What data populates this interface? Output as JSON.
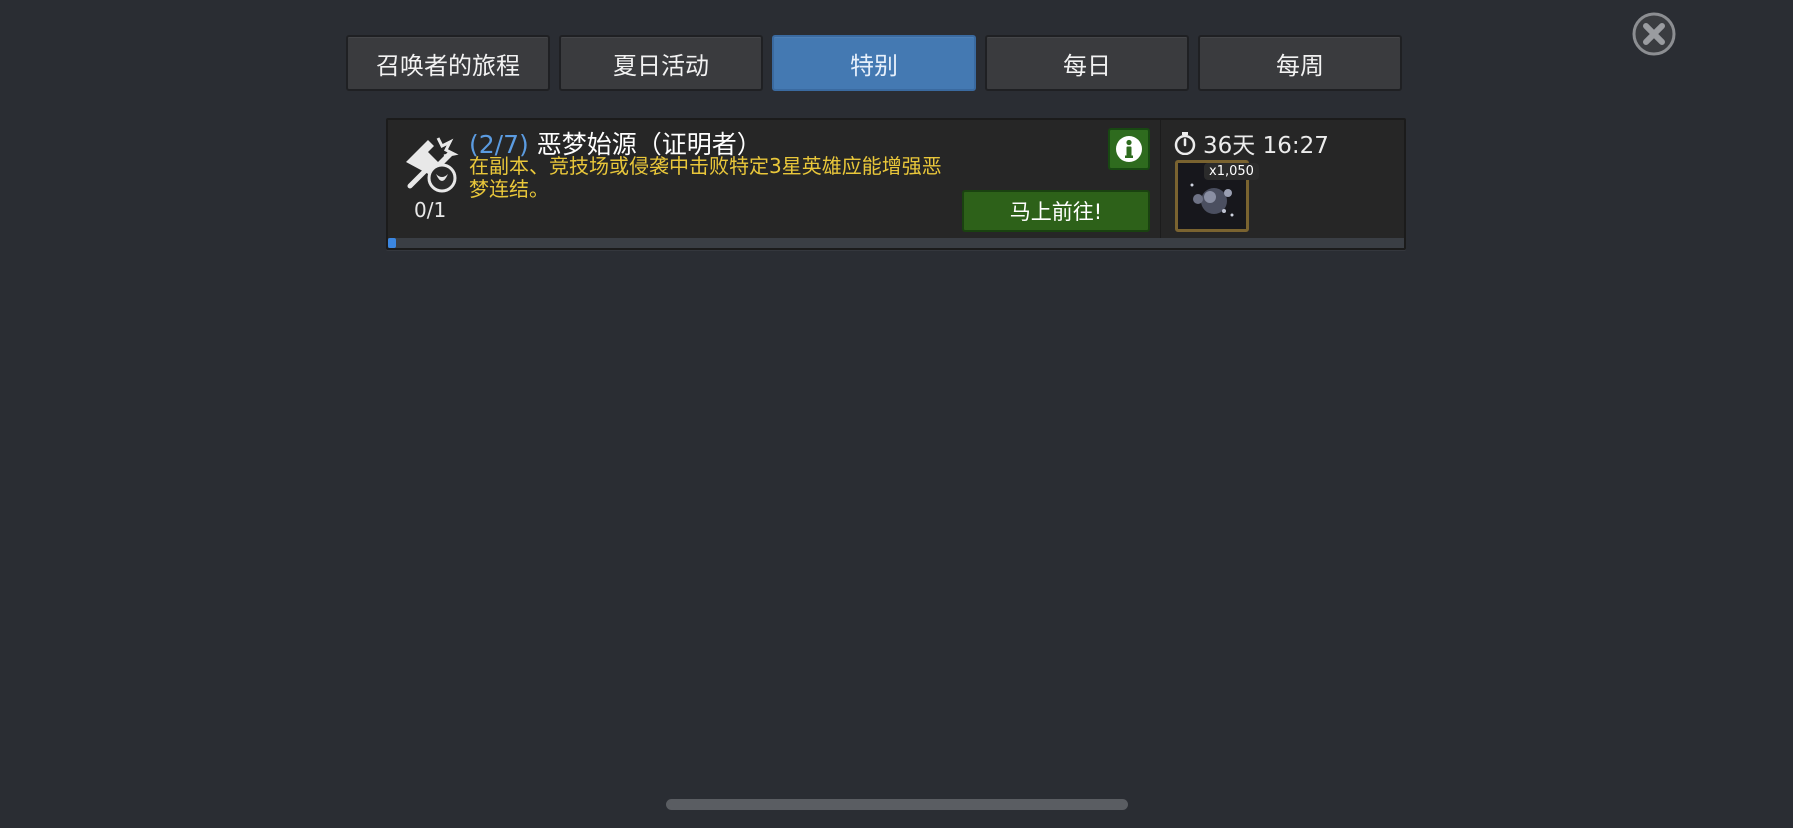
{
  "tabs": [
    {
      "label": "召唤者的旅程",
      "active": false
    },
    {
      "label": "夏日活动",
      "active": false
    },
    {
      "label": "特别",
      "active": true
    },
    {
      "label": "每日",
      "active": false
    },
    {
      "label": "每周",
      "active": false
    }
  ],
  "quest": {
    "stage": "(2/7)",
    "title": "恶梦始源（证明者）",
    "description": "在副本、竞技场或侵袭中击败特定3星英雄应能增强恶梦连结。",
    "count": "0/1",
    "progress": 0,
    "go_label": "马上前往!",
    "timer": "36天 16:27",
    "reward": {
      "quantity": "x1,050",
      "icon": "orb-reward-icon"
    }
  },
  "colors": {
    "background": "#2a2d33",
    "tab_active": "#4479b2",
    "stage": "#5b9be0",
    "description": "#e9c73a",
    "button_green": "#2d6119",
    "progress": "#3b86e0"
  }
}
